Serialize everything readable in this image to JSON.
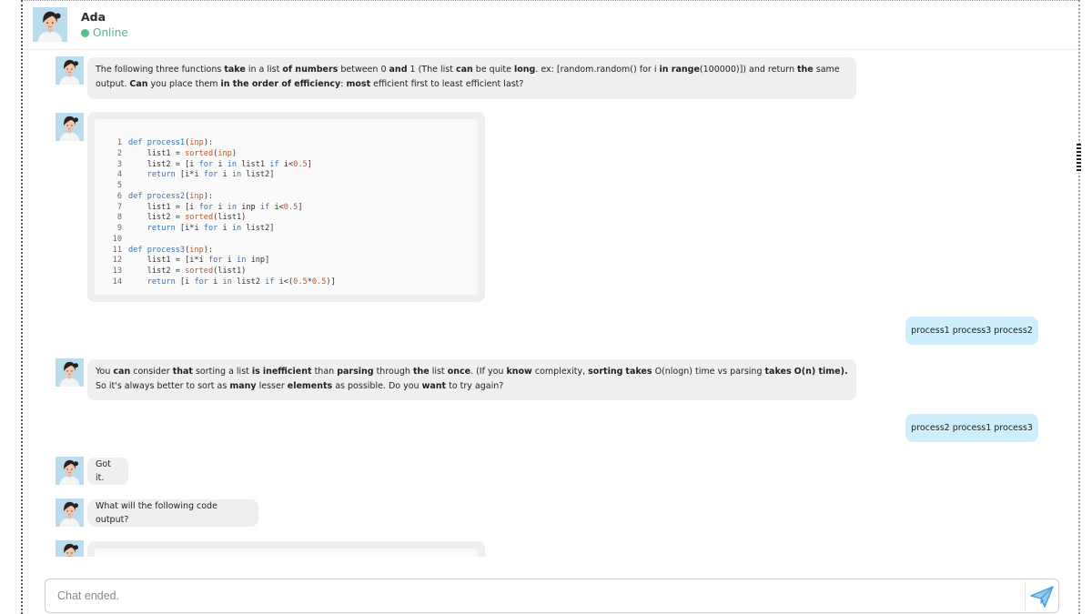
{
  "header": {
    "agent_name": "Ada",
    "status": "Online",
    "status_color": "#56c08d"
  },
  "messages": {
    "m1": {
      "sender": "agent",
      "segments": [
        {
          "t": "The following three functions ",
          "b": false
        },
        {
          "t": "take",
          "b": true
        },
        {
          "t": " in a list ",
          "b": false
        },
        {
          "t": "of numbers",
          "b": true
        },
        {
          "t": " between 0 ",
          "b": false
        },
        {
          "t": "and",
          "b": true
        },
        {
          "t": " 1 (The list ",
          "b": false
        },
        {
          "t": "can",
          "b": true
        },
        {
          "t": " be quite ",
          "b": false
        },
        {
          "t": "long",
          "b": true
        },
        {
          "t": ". ex: [random.random() for i ",
          "b": false
        },
        {
          "t": "in range",
          "b": true
        },
        {
          "t": "(100000)]) and return ",
          "b": false
        },
        {
          "t": "the",
          "b": true
        },
        {
          "t": " same output. ",
          "b": false
        },
        {
          "t": "Can",
          "b": true
        },
        {
          "t": " you place them ",
          "b": false
        },
        {
          "t": "in the order of efficiency",
          "b": true
        },
        {
          "t": ": ",
          "b": false
        },
        {
          "t": "most",
          "b": true
        },
        {
          "t": " efficient first to least efficient last?",
          "b": false
        }
      ]
    },
    "code1": {
      "sender": "agent",
      "lines": [
        [
          {
            "c": "ln",
            "t": "1"
          },
          {
            "c": "kw",
            "t": "def "
          },
          {
            "c": "fn",
            "t": "process1"
          },
          {
            "c": "",
            "t": "("
          },
          {
            "c": "nm",
            "t": "inp"
          },
          {
            "c": "",
            "t": "):"
          }
        ],
        [
          {
            "c": "ln",
            "t": "2"
          },
          {
            "c": "",
            "t": "    list1 = "
          },
          {
            "c": "nm",
            "t": "sorted"
          },
          {
            "c": "",
            "t": "("
          },
          {
            "c": "nm",
            "t": "inp"
          },
          {
            "c": "",
            "t": ")"
          }
        ],
        [
          {
            "c": "ln",
            "t": "3"
          },
          {
            "c": "",
            "t": "    list2 = [i "
          },
          {
            "c": "kw",
            "t": "for"
          },
          {
            "c": "",
            "t": " i "
          },
          {
            "c": "kw",
            "t": "in"
          },
          {
            "c": "",
            "t": " list1 "
          },
          {
            "c": "kw",
            "t": "if"
          },
          {
            "c": "",
            "t": " i<"
          },
          {
            "c": "nm",
            "t": "0.5"
          },
          {
            "c": "",
            "t": "]"
          }
        ],
        [
          {
            "c": "ln",
            "t": "4"
          },
          {
            "c": "",
            "t": "    "
          },
          {
            "c": "kw",
            "t": "return"
          },
          {
            "c": "",
            "t": " [i*i "
          },
          {
            "c": "kw",
            "t": "for"
          },
          {
            "c": "",
            "t": " i "
          },
          {
            "c": "kw",
            "t": "in"
          },
          {
            "c": "",
            "t": " list2]"
          }
        ],
        [
          {
            "c": "ln",
            "t": "5"
          }
        ],
        [
          {
            "c": "ln",
            "t": "6"
          },
          {
            "c": "kw",
            "t": "def "
          },
          {
            "c": "fn",
            "t": "process2"
          },
          {
            "c": "",
            "t": "("
          },
          {
            "c": "nm",
            "t": "inp"
          },
          {
            "c": "",
            "t": "):"
          }
        ],
        [
          {
            "c": "ln",
            "t": "7"
          },
          {
            "c": "",
            "t": "    list1 = [i "
          },
          {
            "c": "kw",
            "t": "for"
          },
          {
            "c": "",
            "t": " i "
          },
          {
            "c": "kw",
            "t": "in"
          },
          {
            "c": "",
            "t": " inp "
          },
          {
            "c": "kw",
            "t": "if"
          },
          {
            "c": "",
            "t": " i<"
          },
          {
            "c": "nm",
            "t": "0.5"
          },
          {
            "c": "",
            "t": "]"
          }
        ],
        [
          {
            "c": "ln",
            "t": "8"
          },
          {
            "c": "",
            "t": "    list2 = "
          },
          {
            "c": "nm",
            "t": "sorted"
          },
          {
            "c": "",
            "t": "(list1)"
          }
        ],
        [
          {
            "c": "ln",
            "t": "9"
          },
          {
            "c": "",
            "t": "    "
          },
          {
            "c": "kw",
            "t": "return"
          },
          {
            "c": "",
            "t": " [i*i "
          },
          {
            "c": "kw",
            "t": "for"
          },
          {
            "c": "",
            "t": " i "
          },
          {
            "c": "kw",
            "t": "in"
          },
          {
            "c": "",
            "t": " list2]"
          }
        ],
        [
          {
            "c": "ln",
            "t": "10"
          }
        ],
        [
          {
            "c": "ln",
            "t": "11"
          },
          {
            "c": "kw",
            "t": "def "
          },
          {
            "c": "fn",
            "t": "process3"
          },
          {
            "c": "",
            "t": "("
          },
          {
            "c": "nm",
            "t": "inp"
          },
          {
            "c": "",
            "t": "):"
          }
        ],
        [
          {
            "c": "ln",
            "t": "12"
          },
          {
            "c": "",
            "t": "    list1 = [i*i "
          },
          {
            "c": "kw",
            "t": "for"
          },
          {
            "c": "",
            "t": " i "
          },
          {
            "c": "kw",
            "t": "in"
          },
          {
            "c": "",
            "t": " inp]"
          }
        ],
        [
          {
            "c": "ln",
            "t": "13"
          },
          {
            "c": "",
            "t": "    list2 = "
          },
          {
            "c": "nm",
            "t": "sorted"
          },
          {
            "c": "",
            "t": "(list1)"
          }
        ],
        [
          {
            "c": "ln",
            "t": "14"
          },
          {
            "c": "",
            "t": "    "
          },
          {
            "c": "kw",
            "t": "return"
          },
          {
            "c": "",
            "t": " [i "
          },
          {
            "c": "kw",
            "t": "for"
          },
          {
            "c": "",
            "t": " i "
          },
          {
            "c": "kw",
            "t": "in"
          },
          {
            "c": "",
            "t": " list2 "
          },
          {
            "c": "kw",
            "t": "if"
          },
          {
            "c": "",
            "t": " i<("
          },
          {
            "c": "nm",
            "t": "0.5"
          },
          {
            "c": "",
            "t": "*"
          },
          {
            "c": "nm",
            "t": "0.5"
          },
          {
            "c": "",
            "t": ")]"
          }
        ]
      ]
    },
    "u1": {
      "sender": "user",
      "text": "process1 process3 process2"
    },
    "m2": {
      "sender": "agent",
      "segments": [
        {
          "t": "You ",
          "b": false
        },
        {
          "t": "can",
          "b": true
        },
        {
          "t": " consider ",
          "b": false
        },
        {
          "t": "that",
          "b": true
        },
        {
          "t": " sorting a list ",
          "b": false
        },
        {
          "t": "is",
          "b": true
        },
        {
          "t": " ",
          "b": false
        },
        {
          "t": "inefficient",
          "b": true
        },
        {
          "t": " than ",
          "b": false
        },
        {
          "t": "parsing",
          "b": true
        },
        {
          "t": " through ",
          "b": false
        },
        {
          "t": "the",
          "b": true
        },
        {
          "t": " list ",
          "b": false
        },
        {
          "t": "once",
          "b": true
        },
        {
          "t": ". (If you ",
          "b": false
        },
        {
          "t": "know",
          "b": true
        },
        {
          "t": " complexity, ",
          "b": false
        },
        {
          "t": "sorting",
          "b": true
        },
        {
          "t": " ",
          "b": false
        },
        {
          "t": "takes",
          "b": true
        },
        {
          "t": " O(nlogn) time vs parsing ",
          "b": false
        },
        {
          "t": "takes",
          "b": true
        },
        {
          "t": " ",
          "b": false
        },
        {
          "t": "O(n) time).",
          "b": true
        },
        {
          "t": " So it's always better to sort as ",
          "b": false
        },
        {
          "t": "many",
          "b": true
        },
        {
          "t": " lesser ",
          "b": false
        },
        {
          "t": "elements",
          "b": true
        },
        {
          "t": " as possible. Do you ",
          "b": false
        },
        {
          "t": "want",
          "b": true
        },
        {
          "t": " to try again?",
          "b": false
        }
      ]
    },
    "u2": {
      "sender": "user",
      "text": "process2 process1 process3"
    },
    "m3": {
      "sender": "agent",
      "text": "Got it."
    },
    "m4": {
      "sender": "agent",
      "text": "What will the following code output?"
    }
  },
  "input": {
    "placeholder": "Chat ended."
  },
  "icons": {
    "avatar": "agent-avatar-icon",
    "send": "paper-plane-icon"
  },
  "colors": {
    "agent_bubble": "#efefef",
    "user_bubble": "#cdeefa",
    "send_icon": "#5aa9dc"
  }
}
